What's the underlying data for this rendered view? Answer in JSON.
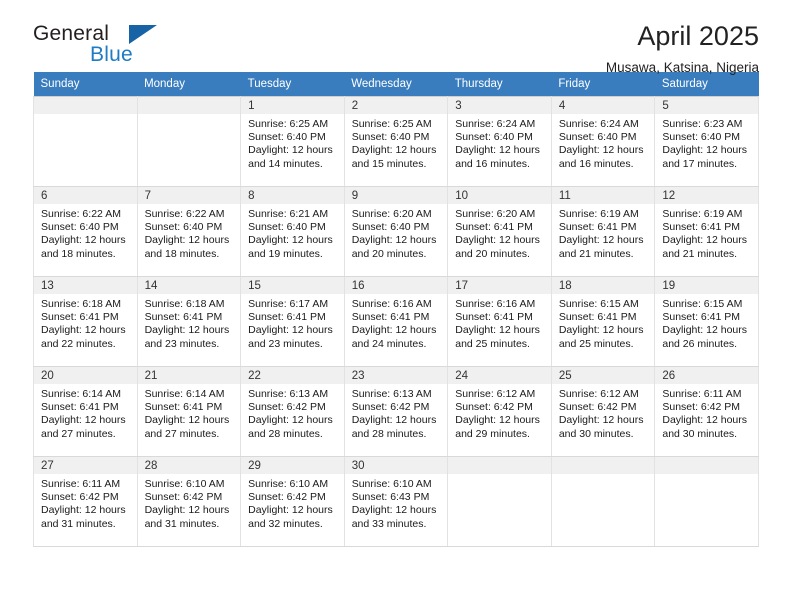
{
  "brand": {
    "name_top": "General",
    "name_bottom": "Blue",
    "accent_color": "#1e7bc4"
  },
  "header": {
    "title": "April 2025",
    "location": "Musawa, Katsina, Nigeria"
  },
  "calendar": {
    "header_color": "#3a7dbf",
    "weekday_headers": [
      "Sunday",
      "Monday",
      "Tuesday",
      "Wednesday",
      "Thursday",
      "Friday",
      "Saturday"
    ],
    "weeks": [
      [
        {
          "day": "",
          "lines": []
        },
        {
          "day": "",
          "lines": []
        },
        {
          "day": "1",
          "lines": [
            "Sunrise: 6:25 AM",
            "Sunset: 6:40 PM",
            "Daylight: 12 hours",
            "and 14 minutes."
          ]
        },
        {
          "day": "2",
          "lines": [
            "Sunrise: 6:25 AM",
            "Sunset: 6:40 PM",
            "Daylight: 12 hours",
            "and 15 minutes."
          ]
        },
        {
          "day": "3",
          "lines": [
            "Sunrise: 6:24 AM",
            "Sunset: 6:40 PM",
            "Daylight: 12 hours",
            "and 16 minutes."
          ]
        },
        {
          "day": "4",
          "lines": [
            "Sunrise: 6:24 AM",
            "Sunset: 6:40 PM",
            "Daylight: 12 hours",
            "and 16 minutes."
          ]
        },
        {
          "day": "5",
          "lines": [
            "Sunrise: 6:23 AM",
            "Sunset: 6:40 PM",
            "Daylight: 12 hours",
            "and 17 minutes."
          ]
        }
      ],
      [
        {
          "day": "6",
          "lines": [
            "Sunrise: 6:22 AM",
            "Sunset: 6:40 PM",
            "Daylight: 12 hours",
            "and 18 minutes."
          ]
        },
        {
          "day": "7",
          "lines": [
            "Sunrise: 6:22 AM",
            "Sunset: 6:40 PM",
            "Daylight: 12 hours",
            "and 18 minutes."
          ]
        },
        {
          "day": "8",
          "lines": [
            "Sunrise: 6:21 AM",
            "Sunset: 6:40 PM",
            "Daylight: 12 hours",
            "and 19 minutes."
          ]
        },
        {
          "day": "9",
          "lines": [
            "Sunrise: 6:20 AM",
            "Sunset: 6:40 PM",
            "Daylight: 12 hours",
            "and 20 minutes."
          ]
        },
        {
          "day": "10",
          "lines": [
            "Sunrise: 6:20 AM",
            "Sunset: 6:41 PM",
            "Daylight: 12 hours",
            "and 20 minutes."
          ]
        },
        {
          "day": "11",
          "lines": [
            "Sunrise: 6:19 AM",
            "Sunset: 6:41 PM",
            "Daylight: 12 hours",
            "and 21 minutes."
          ]
        },
        {
          "day": "12",
          "lines": [
            "Sunrise: 6:19 AM",
            "Sunset: 6:41 PM",
            "Daylight: 12 hours",
            "and 21 minutes."
          ]
        }
      ],
      [
        {
          "day": "13",
          "lines": [
            "Sunrise: 6:18 AM",
            "Sunset: 6:41 PM",
            "Daylight: 12 hours",
            "and 22 minutes."
          ]
        },
        {
          "day": "14",
          "lines": [
            "Sunrise: 6:18 AM",
            "Sunset: 6:41 PM",
            "Daylight: 12 hours",
            "and 23 minutes."
          ]
        },
        {
          "day": "15",
          "lines": [
            "Sunrise: 6:17 AM",
            "Sunset: 6:41 PM",
            "Daylight: 12 hours",
            "and 23 minutes."
          ]
        },
        {
          "day": "16",
          "lines": [
            "Sunrise: 6:16 AM",
            "Sunset: 6:41 PM",
            "Daylight: 12 hours",
            "and 24 minutes."
          ]
        },
        {
          "day": "17",
          "lines": [
            "Sunrise: 6:16 AM",
            "Sunset: 6:41 PM",
            "Daylight: 12 hours",
            "and 25 minutes."
          ]
        },
        {
          "day": "18",
          "lines": [
            "Sunrise: 6:15 AM",
            "Sunset: 6:41 PM",
            "Daylight: 12 hours",
            "and 25 minutes."
          ]
        },
        {
          "day": "19",
          "lines": [
            "Sunrise: 6:15 AM",
            "Sunset: 6:41 PM",
            "Daylight: 12 hours",
            "and 26 minutes."
          ]
        }
      ],
      [
        {
          "day": "20",
          "lines": [
            "Sunrise: 6:14 AM",
            "Sunset: 6:41 PM",
            "Daylight: 12 hours",
            "and 27 minutes."
          ]
        },
        {
          "day": "21",
          "lines": [
            "Sunrise: 6:14 AM",
            "Sunset: 6:41 PM",
            "Daylight: 12 hours",
            "and 27 minutes."
          ]
        },
        {
          "day": "22",
          "lines": [
            "Sunrise: 6:13 AM",
            "Sunset: 6:42 PM",
            "Daylight: 12 hours",
            "and 28 minutes."
          ]
        },
        {
          "day": "23",
          "lines": [
            "Sunrise: 6:13 AM",
            "Sunset: 6:42 PM",
            "Daylight: 12 hours",
            "and 28 minutes."
          ]
        },
        {
          "day": "24",
          "lines": [
            "Sunrise: 6:12 AM",
            "Sunset: 6:42 PM",
            "Daylight: 12 hours",
            "and 29 minutes."
          ]
        },
        {
          "day": "25",
          "lines": [
            "Sunrise: 6:12 AM",
            "Sunset: 6:42 PM",
            "Daylight: 12 hours",
            "and 30 minutes."
          ]
        },
        {
          "day": "26",
          "lines": [
            "Sunrise: 6:11 AM",
            "Sunset: 6:42 PM",
            "Daylight: 12 hours",
            "and 30 minutes."
          ]
        }
      ],
      [
        {
          "day": "27",
          "lines": [
            "Sunrise: 6:11 AM",
            "Sunset: 6:42 PM",
            "Daylight: 12 hours",
            "and 31 minutes."
          ]
        },
        {
          "day": "28",
          "lines": [
            "Sunrise: 6:10 AM",
            "Sunset: 6:42 PM",
            "Daylight: 12 hours",
            "and 31 minutes."
          ]
        },
        {
          "day": "29",
          "lines": [
            "Sunrise: 6:10 AM",
            "Sunset: 6:42 PM",
            "Daylight: 12 hours",
            "and 32 minutes."
          ]
        },
        {
          "day": "30",
          "lines": [
            "Sunrise: 6:10 AM",
            "Sunset: 6:43 PM",
            "Daylight: 12 hours",
            "and 33 minutes."
          ]
        },
        {
          "day": "",
          "lines": []
        },
        {
          "day": "",
          "lines": []
        },
        {
          "day": "",
          "lines": []
        }
      ]
    ]
  }
}
